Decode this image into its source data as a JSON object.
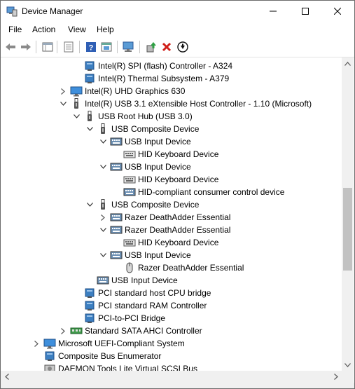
{
  "window": {
    "title": "Device Manager"
  },
  "menu": [
    "File",
    "Action",
    "View",
    "Help"
  ],
  "toolbar": [
    "back-icon",
    "forward-icon",
    "properties-grid-icon",
    "details-icon",
    "help-icon",
    "show-pane-icon",
    "scan-hardware-icon",
    "update-driver-icon",
    "uninstall-icon",
    "disable-icon"
  ],
  "tree": [
    {
      "depth": 5,
      "exp": "none",
      "icon": "chip",
      "label": "Intel(R) SPI (flash) Controller - A324"
    },
    {
      "depth": 5,
      "exp": "none",
      "icon": "chip",
      "label": "Intel(R) Thermal Subsystem - A379"
    },
    {
      "depth": 4,
      "exp": "collapsed",
      "icon": "monitor",
      "label": "Intel(R) UHD Graphics 630"
    },
    {
      "depth": 4,
      "exp": "expanded",
      "icon": "usb",
      "label": "Intel(R) USB 3.1 eXtensible Host Controller - 1.10 (Microsoft)"
    },
    {
      "depth": 5,
      "exp": "expanded",
      "icon": "usb",
      "label": "USB Root Hub (USB 3.0)"
    },
    {
      "depth": 6,
      "exp": "expanded",
      "icon": "usb",
      "label": "USB Composite Device"
    },
    {
      "depth": 7,
      "exp": "expanded",
      "icon": "hid",
      "label": "USB Input Device"
    },
    {
      "depth": 8,
      "exp": "none",
      "icon": "keyboard",
      "label": "HID Keyboard Device"
    },
    {
      "depth": 7,
      "exp": "expanded",
      "icon": "hid",
      "label": "USB Input Device"
    },
    {
      "depth": 8,
      "exp": "none",
      "icon": "keyboard",
      "label": "HID Keyboard Device"
    },
    {
      "depth": 8,
      "exp": "none",
      "icon": "hid",
      "label": "HID-compliant consumer control device"
    },
    {
      "depth": 6,
      "exp": "expanded",
      "icon": "usb",
      "label": "USB Composite Device"
    },
    {
      "depth": 7,
      "exp": "collapsed",
      "icon": "hid",
      "label": "Razer DeathAdder Essential"
    },
    {
      "depth": 7,
      "exp": "expanded",
      "icon": "hid",
      "label": "Razer DeathAdder Essential"
    },
    {
      "depth": 8,
      "exp": "none",
      "icon": "keyboard",
      "label": "HID Keyboard Device"
    },
    {
      "depth": 7,
      "exp": "expanded",
      "icon": "hid",
      "label": "USB Input Device"
    },
    {
      "depth": 8,
      "exp": "none",
      "icon": "mouse",
      "label": "Razer DeathAdder Essential"
    },
    {
      "depth": 6,
      "exp": "none",
      "icon": "hid",
      "label": "USB Input Device"
    },
    {
      "depth": 5,
      "exp": "none",
      "icon": "chip",
      "label": "PCI standard host CPU bridge"
    },
    {
      "depth": 5,
      "exp": "none",
      "icon": "chip",
      "label": "PCI standard RAM Controller"
    },
    {
      "depth": 5,
      "exp": "none",
      "icon": "chip",
      "label": "PCI-to-PCI Bridge"
    },
    {
      "depth": 4,
      "exp": "collapsed",
      "icon": "sata",
      "label": "Standard SATA AHCI Controller"
    },
    {
      "depth": 2,
      "exp": "collapsed",
      "icon": "monitor",
      "label": "Microsoft UEFI-Compliant System"
    },
    {
      "depth": 2,
      "exp": "none",
      "icon": "chip",
      "label": "Composite Bus Enumerator"
    },
    {
      "depth": 2,
      "exp": "none",
      "icon": "disk",
      "label": "DAEMON Tools Lite Virtual SCSI Bus"
    }
  ]
}
